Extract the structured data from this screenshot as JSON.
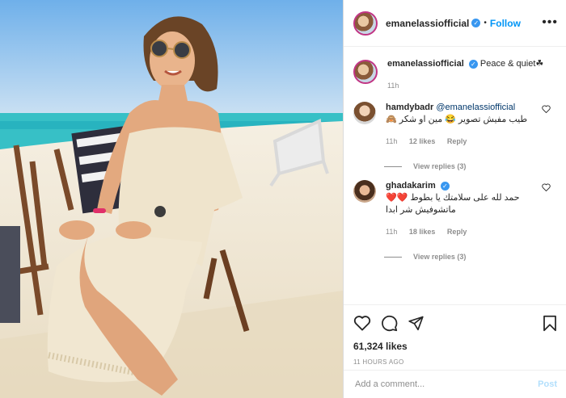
{
  "post": {
    "username": "emanelassiofficial",
    "follow_label": "Follow",
    "separator": "•",
    "more": "•••",
    "caption": "Peace & quiet☘",
    "caption_time": "11h"
  },
  "comments": [
    {
      "username": "hamdybadr",
      "mention": "@emanelassiofficial",
      "text": "طيب مفيش تصوير 😂 مين او شكر 🙈",
      "time": "11h",
      "likes": "12 likes",
      "reply": "Reply",
      "view_replies": "View replies (3)"
    },
    {
      "username": "ghadakarim",
      "text": "حمد لله على سلامتك يا بطوط ❤️❤️ ماتشوفيش شر ابدا",
      "time": "11h",
      "likes": "18 likes",
      "reply": "Reply",
      "view_replies": "View replies (3)"
    }
  ],
  "stats": {
    "likes": "61,324 likes",
    "time_ago": "11 HOURS AGO"
  },
  "add_comment": {
    "placeholder": "Add a comment...",
    "post_label": "Post"
  },
  "colors": {
    "accent": "#0095f6",
    "verified": "#3897f0",
    "sky": "#9fc9ec",
    "sea": "#3cc3c8",
    "sand": "#efe6d3"
  },
  "icons": [
    "heart-icon",
    "comment-icon",
    "share-icon",
    "bookmark-icon",
    "verified-icon",
    "more-icon"
  ]
}
